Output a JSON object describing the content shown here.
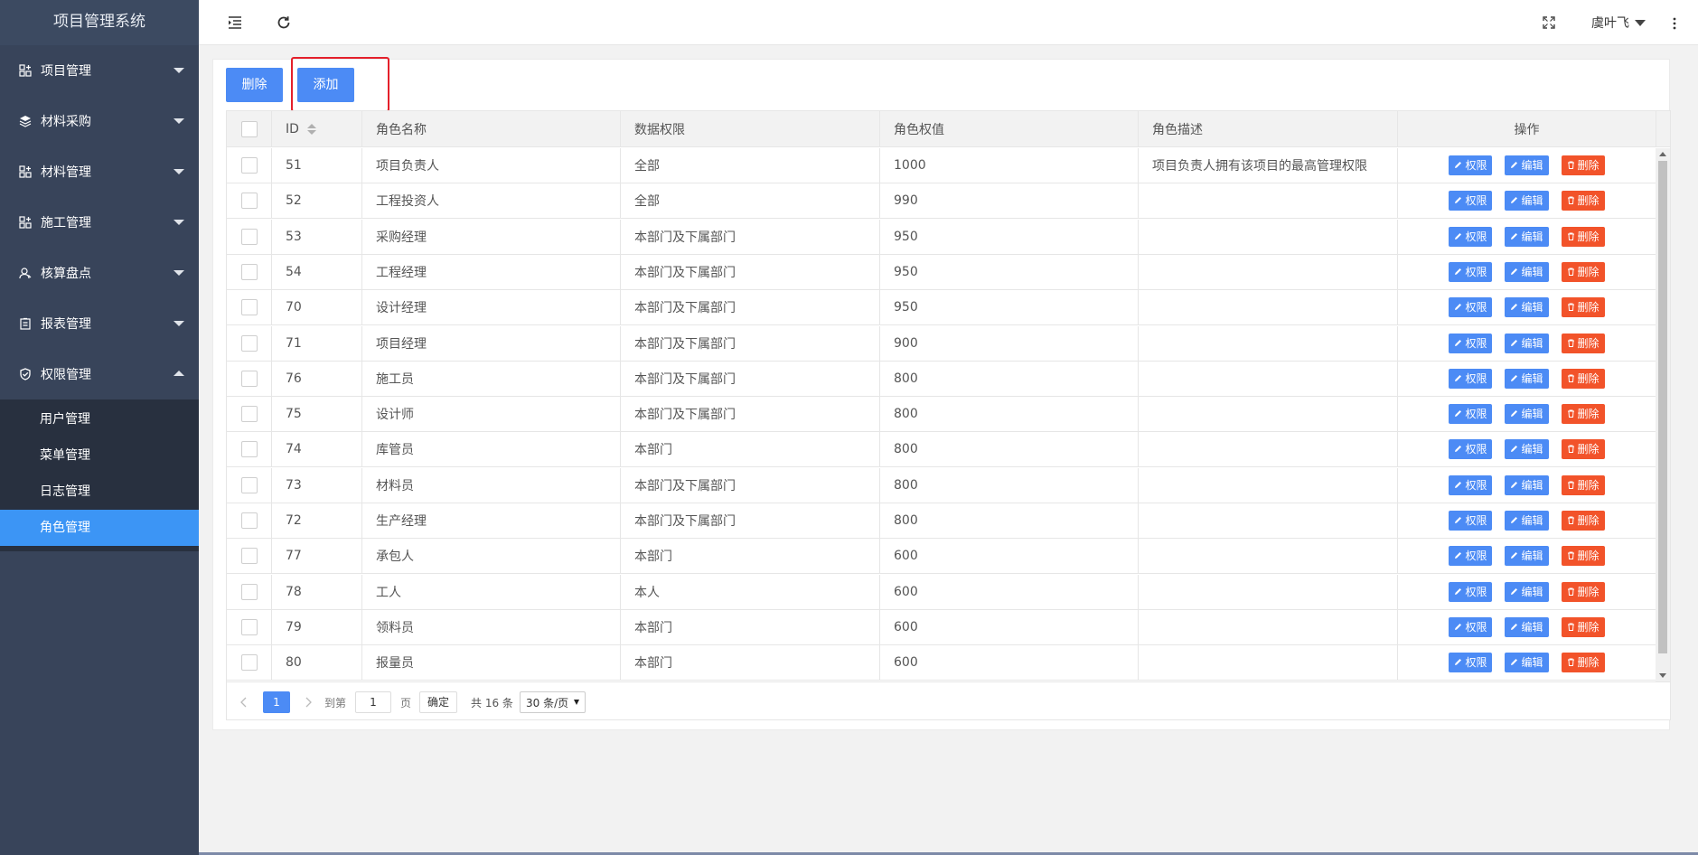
{
  "app": {
    "title": "项目管理系统"
  },
  "sidebar": {
    "items": [
      {
        "label": "项目管理",
        "icon": "apps-icon",
        "expanded": false
      },
      {
        "label": "材料采购",
        "icon": "layers-icon",
        "expanded": false
      },
      {
        "label": "材料管理",
        "icon": "apps-icon",
        "expanded": false
      },
      {
        "label": "施工管理",
        "icon": "apps-icon",
        "expanded": false
      },
      {
        "label": "核算盘点",
        "icon": "user-icon",
        "expanded": false
      },
      {
        "label": "报表管理",
        "icon": "clipboard-icon",
        "expanded": false
      },
      {
        "label": "权限管理",
        "icon": "shield-icon",
        "expanded": true
      }
    ],
    "subitems": [
      {
        "label": "用户管理",
        "active": false
      },
      {
        "label": "菜单管理",
        "active": false
      },
      {
        "label": "日志管理",
        "active": false
      },
      {
        "label": "角色管理",
        "active": true
      }
    ]
  },
  "header": {
    "user_name": "虞叶飞",
    "icons": [
      "menu-fold-icon",
      "refresh-icon",
      "fullscreen-icon",
      "more-vertical-icon"
    ]
  },
  "toolbar": {
    "delete_label": "删除",
    "add_label": "添加"
  },
  "table": {
    "columns": [
      "ID",
      "角色名称",
      "数据权限",
      "角色权值",
      "角色描述",
      "操作"
    ],
    "rows": [
      {
        "id": "51",
        "name": "项目负责人",
        "scope": "全部",
        "weight": "1000",
        "desc": "项目负责人拥有该项目的最高管理权限"
      },
      {
        "id": "52",
        "name": "工程投资人",
        "scope": "全部",
        "weight": "990",
        "desc": ""
      },
      {
        "id": "53",
        "name": "采购经理",
        "scope": "本部门及下属部门",
        "weight": "950",
        "desc": ""
      },
      {
        "id": "54",
        "name": "工程经理",
        "scope": "本部门及下属部门",
        "weight": "950",
        "desc": ""
      },
      {
        "id": "70",
        "name": "设计经理",
        "scope": "本部门及下属部门",
        "weight": "950",
        "desc": ""
      },
      {
        "id": "71",
        "name": "项目经理",
        "scope": "本部门及下属部门",
        "weight": "900",
        "desc": ""
      },
      {
        "id": "76",
        "name": "施工员",
        "scope": "本部门及下属部门",
        "weight": "800",
        "desc": ""
      },
      {
        "id": "75",
        "name": "设计师",
        "scope": "本部门及下属部门",
        "weight": "800",
        "desc": ""
      },
      {
        "id": "74",
        "name": "库管员",
        "scope": "本部门",
        "weight": "800",
        "desc": ""
      },
      {
        "id": "73",
        "name": "材料员",
        "scope": "本部门及下属部门",
        "weight": "800",
        "desc": ""
      },
      {
        "id": "72",
        "name": "生产经理",
        "scope": "本部门及下属部门",
        "weight": "800",
        "desc": ""
      },
      {
        "id": "77",
        "name": "承包人",
        "scope": "本部门",
        "weight": "600",
        "desc": ""
      },
      {
        "id": "78",
        "name": "工人",
        "scope": "本人",
        "weight": "600",
        "desc": ""
      },
      {
        "id": "79",
        "name": "领料员",
        "scope": "本部门",
        "weight": "600",
        "desc": ""
      },
      {
        "id": "80",
        "name": "报量员",
        "scope": "本部门",
        "weight": "600",
        "desc": ""
      }
    ],
    "actions": {
      "permission": "权限",
      "edit": "编辑",
      "delete": "删除"
    }
  },
  "pagination": {
    "current_page": "1",
    "goto_label": "到第",
    "goto_value": "1",
    "page_unit": "页",
    "confirm_label": "确定",
    "total_label": "共 16 条",
    "page_size_label": "30 条/页"
  },
  "colors": {
    "sidebar_bg": "#38445a",
    "submenu_bg": "#28303f",
    "active_blue": "#3c95f5",
    "button_blue": "#4c8bf5",
    "danger_orange": "#f2532a",
    "highlight_red": "#e4202b"
  }
}
